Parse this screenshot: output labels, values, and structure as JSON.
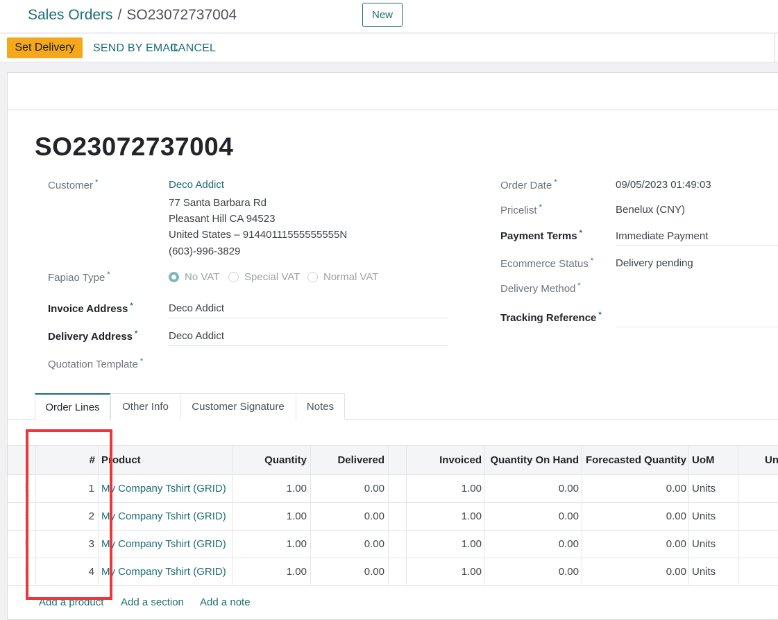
{
  "header": {
    "breadcrumb_parent": "Sales Orders",
    "breadcrumb_separator": "/",
    "breadcrumb_current": "SO23072737004",
    "new_label": "New"
  },
  "actions": {
    "primary_label": "Set Delivery",
    "send_email_label": "SEND BY EMAIL",
    "cancel_label": "CANCEL"
  },
  "order": {
    "title": "SO23072737004",
    "required_mark": "*",
    "customer": {
      "label": "Customer",
      "name": "Deco Addict",
      "address_line1": "77 Santa Barbara Rd",
      "address_line2": "Pleasant Hill CA 94523",
      "address_line3": "United States – 91440111555555555N",
      "phone": "(603)-996-3829"
    },
    "fapiao": {
      "label": "Fapiao Type",
      "options": [
        "No VAT",
        "Special VAT",
        "Normal VAT"
      ],
      "selected": "No VAT"
    },
    "invoice_address": {
      "label": "Invoice Address",
      "value": "Deco Addict"
    },
    "delivery_address": {
      "label": "Delivery Address",
      "value": "Deco Addict"
    },
    "quotation_template": {
      "label": "Quotation Template",
      "value": ""
    },
    "order_date": {
      "label": "Order Date",
      "value": "09/05/2023 01:49:03"
    },
    "pricelist": {
      "label": "Pricelist",
      "value": "Benelux (CNY)"
    },
    "payment_terms": {
      "label": "Payment Terms",
      "value": "Immediate Payment"
    },
    "ecommerce_status": {
      "label": "Ecommerce Status",
      "value": "Delivery pending"
    },
    "delivery_method": {
      "label": "Delivery Method",
      "value": ""
    },
    "tracking_reference": {
      "label": "Tracking Reference",
      "value": ""
    }
  },
  "tabs": [
    "Order Lines",
    "Other Info",
    "Customer Signature",
    "Notes"
  ],
  "lines": {
    "columns": [
      "#",
      "Product",
      "Quantity",
      "Delivered",
      "Invoiced",
      "Quantity On Hand",
      "Forecasted Quantity",
      "UoM",
      "Un"
    ],
    "rows": [
      {
        "num": "1",
        "product": "My Company Tshirt (GRID)",
        "quantity": "1.00",
        "delivered": "0.00",
        "invoiced": "1.00",
        "on_hand": "0.00",
        "forecasted": "0.00",
        "uom": "Units"
      },
      {
        "num": "2",
        "product": "My Company Tshirt (GRID)",
        "quantity": "1.00",
        "delivered": "0.00",
        "invoiced": "1.00",
        "on_hand": "0.00",
        "forecasted": "0.00",
        "uom": "Units"
      },
      {
        "num": "3",
        "product": "My Company Tshirt (GRID)",
        "quantity": "1.00",
        "delivered": "0.00",
        "invoiced": "1.00",
        "on_hand": "0.00",
        "forecasted": "0.00",
        "uom": "Units"
      },
      {
        "num": "4",
        "product": "My Company Tshirt (GRID)",
        "quantity": "1.00",
        "delivered": "0.00",
        "invoiced": "1.00",
        "on_hand": "0.00",
        "forecasted": "0.00",
        "uom": "Units"
      }
    ],
    "add_product": "Add a product",
    "add_section": "Add a section",
    "add_note": "Add a note"
  },
  "colors": {
    "brand": "#1c6e74",
    "primary_button": "#f5a81c",
    "highlight": "#e8383b"
  },
  "icons": {
    "drag_handle": "drag-handle-icon",
    "radio_selected": "radio-selected-icon",
    "radio_empty": "radio-empty-icon"
  }
}
